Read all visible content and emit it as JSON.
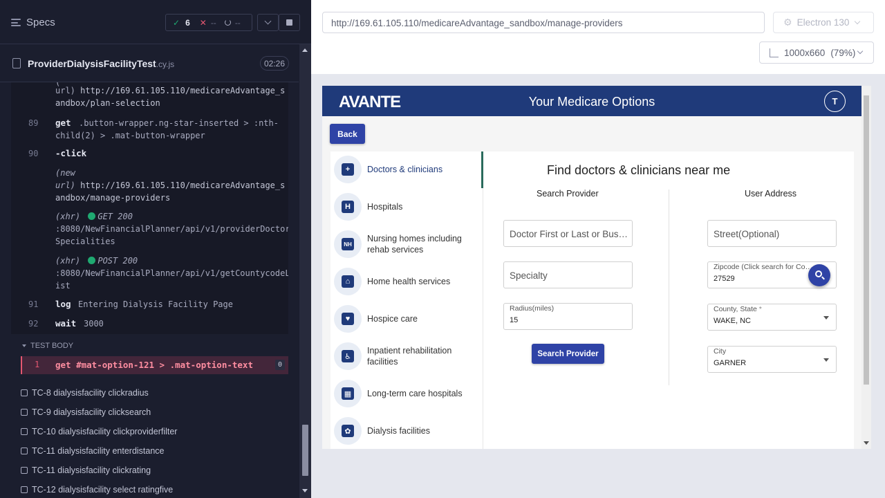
{
  "runner": {
    "specs_label": "Specs",
    "stats": {
      "passed": "6",
      "failed": "--",
      "pending": "--"
    },
    "file": {
      "name": "ProviderDialysisFacilityTest",
      "ext": ".cy.js",
      "timer": "02:26"
    },
    "commands": [
      {
        "num": "",
        "name": "",
        "text": "url)  http://169.61.105.110/medicareAdvantage_s"
      },
      {
        "num": "",
        "name": "",
        "text": "andbox/plan-selection"
      },
      {
        "num": "89",
        "name": "get",
        "text": ".button-wrapper.ng-star-inserted > :nth-"
      },
      {
        "num": "",
        "name": "",
        "text": "child(2) > .mat-button-wrapper"
      },
      {
        "num": "90",
        "name": "-click",
        "text": ""
      },
      {
        "num": "",
        "name": "",
        "text": "(new"
      },
      {
        "num": "",
        "name": "",
        "text": "url)  http://169.61.105.110/medicareAdvantage_s"
      },
      {
        "num": "",
        "name": "",
        "text": "andbox/manage-providers"
      },
      {
        "num": "",
        "name": "",
        "text": "GET 200"
      },
      {
        "num": "",
        "name": "",
        "text": ":8080/NewFinancialPlanner/api/v1/providerDoctor"
      },
      {
        "num": "",
        "name": "",
        "text": "Specialities"
      },
      {
        "num": "",
        "name": "",
        "text": "POST 200"
      },
      {
        "num": "",
        "name": "",
        "text": ":8080/NewFinancialPlanner/api/v1/getCountycodeL"
      },
      {
        "num": "",
        "name": "",
        "text": "ist"
      },
      {
        "num": "91",
        "name": "log",
        "text": "Entering Dialysis Facility Page"
      },
      {
        "num": "92",
        "name": "wait",
        "text": "3000"
      }
    ],
    "xhr_label": "(xhr)",
    "test_body_label": "TEST BODY",
    "failed_cmd": {
      "num": "1",
      "name": "get",
      "text": "#mat-option-121 > .mat-option-text",
      "badge": "0"
    },
    "tests": [
      "TC-8 dialysisfacility clickradius",
      "TC-9 dialysisfacility clicksearch",
      "TC-10 dialysisfacility clickproviderfilter",
      "TC-11 dialysisfacility enterdistance",
      "TC-11 dialysisfacility clickrating",
      "TC-12 dialysisfacility select ratingfive"
    ]
  },
  "browser": {
    "url": "http://169.61.105.110/medicareAdvantage_sandbox/manage-providers",
    "name": "Electron 130",
    "viewport": "1000x660",
    "zoom": "(79%)"
  },
  "app": {
    "logo": "AVANTE",
    "title": "Your Medicare Options",
    "avatar": "T",
    "back_label": "Back",
    "categories": [
      {
        "label": "Doctors & clinicians",
        "icon": "doctor-icon",
        "glyph": "+"
      },
      {
        "label": "Hospitals",
        "icon": "hospital-icon",
        "glyph": "H"
      },
      {
        "label": "Nursing homes including rehab services",
        "icon": "nursing-home-icon",
        "glyph": "NH"
      },
      {
        "label": "Home health services",
        "icon": "home-health-icon",
        "glyph": "⌂"
      },
      {
        "label": "Hospice care",
        "icon": "hospice-icon",
        "glyph": "♥"
      },
      {
        "label": "Inpatient rehabilitation facilities",
        "icon": "rehab-icon",
        "glyph": "♿"
      },
      {
        "label": "Long-term care hospitals",
        "icon": "ltc-hospital-icon",
        "glyph": "▦"
      },
      {
        "label": "Dialysis facilities",
        "icon": "dialysis-icon",
        "glyph": "✿"
      }
    ],
    "heading": "Find doctors & clinicians near me",
    "search_col": "Search Provider",
    "user_col": "User Address",
    "doctor_placeholder": "Doctor First or Last or Business Name",
    "specialty_placeholder": "Specialty",
    "radius_label": "Radius(miles)",
    "radius_value": "15",
    "search_btn": "Search Provider",
    "street_placeholder": "Street(Optional)",
    "zip_label": "Zipcode (Click search for County)",
    "zip_value": "27529",
    "county_label": "County, State",
    "county_req": "*",
    "county_value": "WAKE, NC",
    "city_label": "City",
    "city_value": "GARNER"
  },
  "colors": {
    "runner_bg": "#1b1e2e",
    "pass": "#1fa971",
    "fail": "#e45770",
    "app_header": "#1f3a7a",
    "app_button": "#2f43a6"
  }
}
